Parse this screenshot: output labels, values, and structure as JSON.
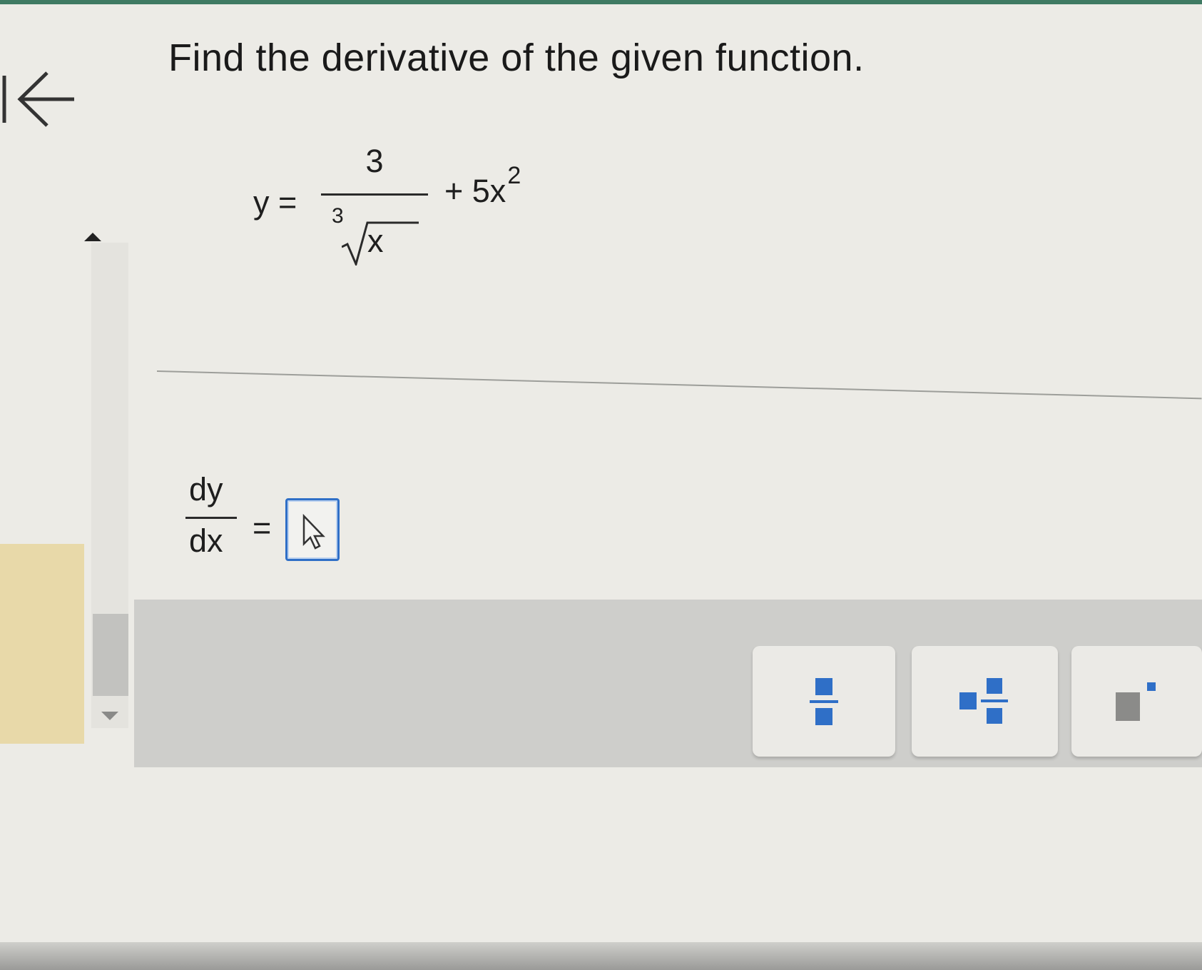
{
  "navigation": {
    "back_icon": "back-arrow-icon"
  },
  "question": {
    "prompt": "Find the derivative of the given function.",
    "function": {
      "lhs": "y =",
      "numerator": "3",
      "root_index": "3",
      "radicand": "x",
      "term_prefix": "+ 5x",
      "exponent": "2"
    }
  },
  "answer": {
    "label_numerator": "dy",
    "label_denominator": "dx",
    "equals": "=",
    "value": ""
  },
  "toolbar": {
    "buttons": [
      {
        "icon": "fraction-template-icon"
      },
      {
        "icon": "mixed-number-template-icon"
      },
      {
        "icon": "exponent-template-icon"
      }
    ]
  },
  "colors": {
    "accent": "#2f6fc7",
    "background": "#ecebe6",
    "toolbar": "#cececb",
    "top_band": "#3f7a63",
    "side_strip": "#e8d9a9"
  }
}
